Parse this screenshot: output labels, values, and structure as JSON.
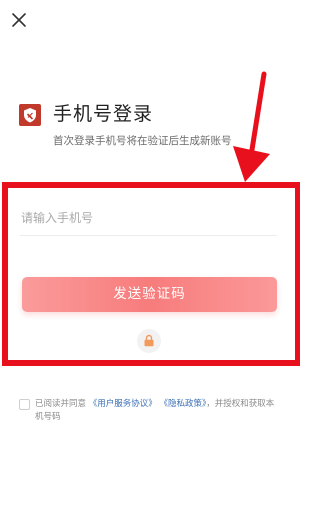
{
  "close_icon": "close-icon",
  "header": {
    "logo_icon": "shield-logo-icon",
    "title": "手机号登录",
    "subtitle": "首次登录手机号将在验证后生成新账号"
  },
  "form": {
    "phone_placeholder": "请输入手机号",
    "phone_value": "",
    "send_code_label": "发送验证码",
    "lock_icon": "lock-icon"
  },
  "agreement": {
    "checked": false,
    "prefix": "已阅读并同意",
    "user_agreement": "《用户服务协议》",
    "privacy_policy": "《隐私政策》",
    "suffix": "，并授权和获取本机号码"
  },
  "annotation": {
    "highlight_color": "#e8101c"
  },
  "colors": {
    "button_gradient_start": "#fb9b9b",
    "button_gradient_mid": "#f77c7c",
    "link": "#3b6fb5",
    "logo": "#c0392b"
  }
}
